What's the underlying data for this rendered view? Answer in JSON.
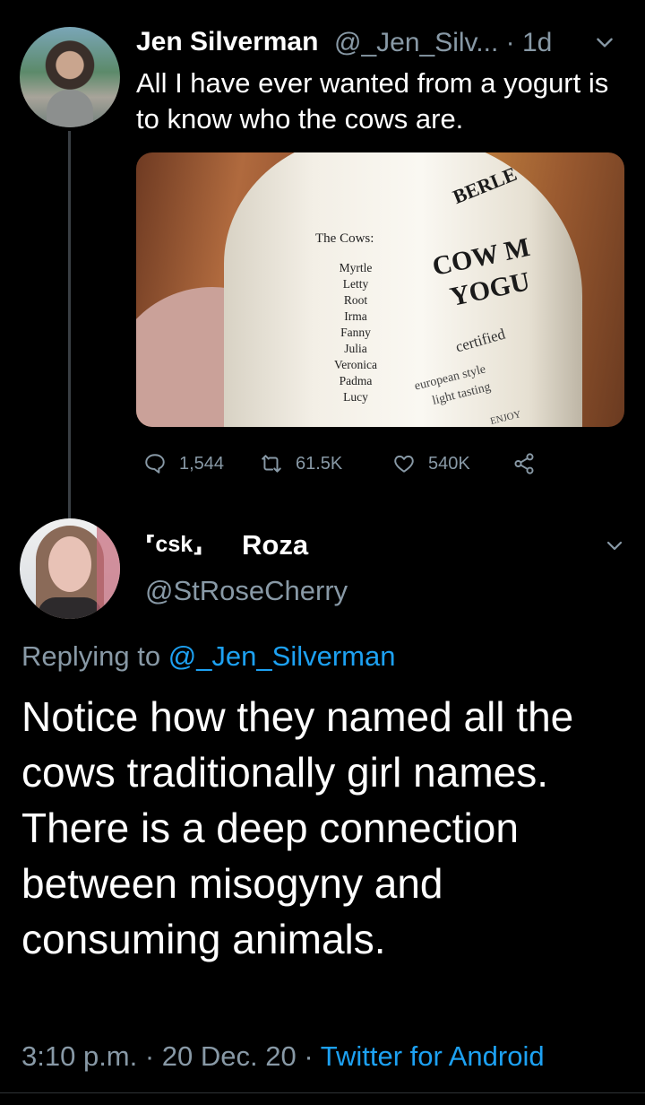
{
  "tweet": {
    "display_name": "Jen Silverman",
    "handle": "@_Jen_Silv...",
    "time": "· 1d",
    "text": "All I have ever wanted from a yogurt is to know who the cows are.",
    "photo": {
      "cows_title": "The Cows:",
      "cows": [
        "Myrtle",
        "Letty",
        "Root",
        "Irma",
        "Fanny",
        "Julia",
        "Veronica",
        "Padma",
        "Lucy"
      ],
      "brand": "BERLE",
      "product_line1": "COW M",
      "product_line2": "YOGU",
      "certified": "certified",
      "european": "european style",
      "light": "light tasting",
      "enjoy": "ENJOY"
    },
    "stats": {
      "replies": "1,544",
      "retweets": "61.5K",
      "likes": "540K"
    }
  },
  "reply": {
    "name_prefix": "⸢csk⸥",
    "display_name": "Roza",
    "handle": "@StRoseCherry",
    "replying_label": "Replying to",
    "replying_handle": "@_Jen_Silverman",
    "text": "Notice how they named all the cows traditionally girl names. There is a deep connection between misogyny and consuming animals.",
    "time": "3:10 p.m.",
    "date": "· 20 Dec. 20 ·",
    "source": "Twitter for Android"
  },
  "colors": {
    "background": "#000000",
    "muted": "#8899a6",
    "link": "#1da1f2"
  }
}
